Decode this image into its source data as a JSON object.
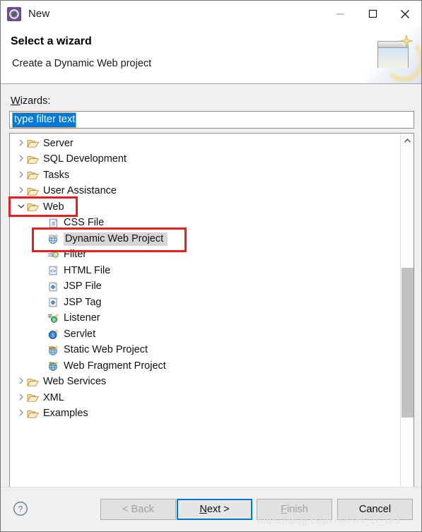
{
  "window": {
    "title": "New",
    "icon": "eclipse-new-wizard-icon",
    "controls": {
      "minimize": "minimize-icon",
      "maximize": "maximize-icon",
      "close": "close-icon"
    }
  },
  "header": {
    "title": "Select a wizard",
    "description": "Create a Dynamic Web project",
    "banner_icon": "web-project-sparkle-icon"
  },
  "body": {
    "wizards_label": "Wizards:",
    "wizards_label_accelerator": "W",
    "filter": {
      "value": "type filter text",
      "selected": true
    }
  },
  "tree": {
    "items": [
      {
        "label": "Server",
        "level": 1,
        "icon": "folder-icon",
        "expander": "collapsed",
        "selected": false
      },
      {
        "label": "SQL Development",
        "level": 1,
        "icon": "folder-icon",
        "expander": "collapsed",
        "selected": false
      },
      {
        "label": "Tasks",
        "level": 1,
        "icon": "folder-icon",
        "expander": "collapsed",
        "selected": false
      },
      {
        "label": "User Assistance",
        "level": 1,
        "icon": "folder-icon",
        "expander": "collapsed",
        "selected": false
      },
      {
        "label": "Web",
        "level": 1,
        "icon": "folder-icon",
        "expander": "expanded",
        "selected": false
      },
      {
        "label": "CSS File",
        "level": 2,
        "icon": "css-file-icon",
        "expander": "none",
        "selected": false
      },
      {
        "label": "Dynamic Web Project",
        "level": 2,
        "icon": "dynamic-web-project-icon",
        "expander": "none",
        "selected": true
      },
      {
        "label": "Filter",
        "level": 2,
        "icon": "filter-icon",
        "expander": "none",
        "selected": false
      },
      {
        "label": "HTML File",
        "level": 2,
        "icon": "html-file-icon",
        "expander": "none",
        "selected": false
      },
      {
        "label": "JSP File",
        "level": 2,
        "icon": "jsp-file-icon",
        "expander": "none",
        "selected": false
      },
      {
        "label": "JSP Tag",
        "level": 2,
        "icon": "jsp-tag-icon",
        "expander": "none",
        "selected": false
      },
      {
        "label": "Listener",
        "level": 2,
        "icon": "listener-icon",
        "expander": "none",
        "selected": false
      },
      {
        "label": "Servlet",
        "level": 2,
        "icon": "servlet-icon",
        "expander": "none",
        "selected": false
      },
      {
        "label": "Static Web Project",
        "level": 2,
        "icon": "static-web-project-icon",
        "expander": "none",
        "selected": false
      },
      {
        "label": "Web Fragment Project",
        "level": 2,
        "icon": "web-fragment-project-icon",
        "expander": "none",
        "selected": false
      },
      {
        "label": "Web Services",
        "level": 1,
        "icon": "folder-icon",
        "expander": "collapsed",
        "selected": false
      },
      {
        "label": "XML",
        "level": 1,
        "icon": "folder-icon",
        "expander": "collapsed",
        "selected": false
      },
      {
        "label": "Examples",
        "level": 1,
        "icon": "folder-icon",
        "expander": "collapsed",
        "selected": false
      }
    ],
    "scrollbar": {
      "up_arrow": "chevron-up-icon",
      "down_arrow": "chevron-down-icon"
    }
  },
  "footer": {
    "help_icon": "help-question-icon",
    "buttons": [
      {
        "label": "< Back",
        "name": "back-button",
        "state": "disabled"
      },
      {
        "label": "Next >",
        "name": "next-button",
        "state": "focused"
      },
      {
        "label": "Finish",
        "name": "finish-button",
        "state": "disabled"
      },
      {
        "label": "Cancel",
        "name": "cancel-button",
        "state": "enabled"
      }
    ]
  },
  "annotations": {
    "boxes": [
      {
        "target": "Web",
        "color": "#ee1d1d"
      },
      {
        "target": "Dynamic Web Project",
        "color": "#ee1d1d"
      }
    ]
  },
  "watermark": "https://blog.csdn.net/shi_zi_183",
  "colors": {
    "selection_blue": "#0078d7",
    "annotation_red": "#ee1d1d",
    "row_selected_gray": "#d6d6d6",
    "dialog_background": "#f0f0f0"
  }
}
